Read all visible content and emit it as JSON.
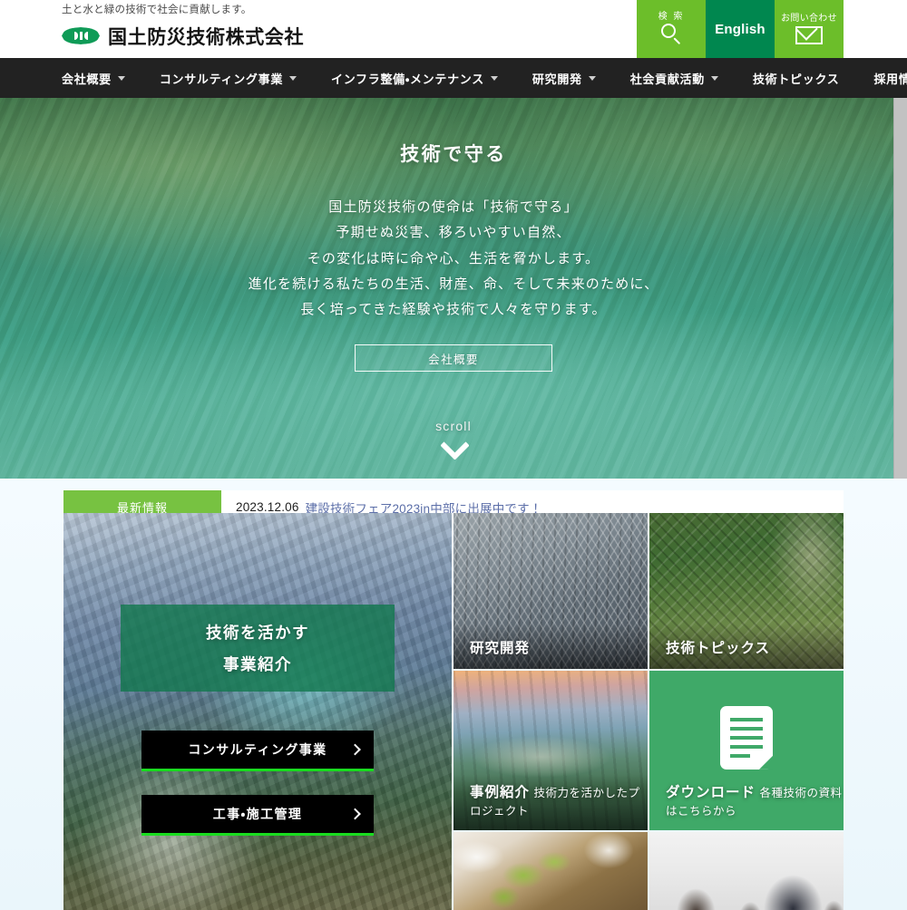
{
  "header": {
    "tagline": "土と水と緑の技術で社会に貢献します。",
    "company_name": "国土防災技術株式会社",
    "logo_alt": "JCE",
    "actions": {
      "search_label": "検 索",
      "english_label": "English",
      "contact_label": "お問い合わせ"
    }
  },
  "nav": {
    "items": [
      {
        "label": "会社概要",
        "has_dropdown": true
      },
      {
        "label": "コンサルティング事業",
        "has_dropdown": true
      },
      {
        "label": "インフラ整備・メンテナンス",
        "has_dropdown": true
      },
      {
        "label": "研究開発",
        "has_dropdown": true
      },
      {
        "label": "社会貢献活動",
        "has_dropdown": true
      },
      {
        "label": "技術トピックス",
        "has_dropdown": false
      },
      {
        "label": "採用情報",
        "has_dropdown": false
      }
    ]
  },
  "hero": {
    "title": "技術で守る",
    "lines": [
      "国土防災技術の使命は「技術で守る」",
      "予期せぬ災害、移ろいやすい自然、",
      "その変化は時に命や心、生活を脅かします。",
      "進化を続ける私たちの生活、財産、命、そして未来のために、",
      "長く培ってきた経験や技術で人々を守ります。"
    ],
    "button_label": "会社概要",
    "scroll_label": "scroll"
  },
  "news": {
    "label": "最新情報",
    "date": "2023.12.06",
    "link_text": "建設技術フェア2023in中部に出展中です！"
  },
  "promo": {
    "line1": "技術を活かす",
    "line2": "事業紹介",
    "buttons": [
      {
        "label": "コンサルティング事業"
      },
      {
        "label": "工事・施工管理"
      }
    ]
  },
  "tiles": [
    {
      "key": "rd",
      "title": "研究開発",
      "subtitle": ""
    },
    {
      "key": "topics",
      "title": "技術トピックス",
      "subtitle": ""
    },
    {
      "key": "case",
      "title": "事例紹介",
      "subtitle": "技術力を活かしたプロジェクト"
    },
    {
      "key": "dl",
      "title": "ダウンロード",
      "subtitle": "各種技術の資料はこちらから"
    }
  ],
  "colors": {
    "brand_green_light": "#6cbe2a",
    "brand_green_dark": "#00874f",
    "news_green": "#77c241",
    "nav_black": "#222222",
    "accent_green": "#19dd1f",
    "download_green": "#3fa968",
    "news_link_blue": "#5b6ea8"
  }
}
